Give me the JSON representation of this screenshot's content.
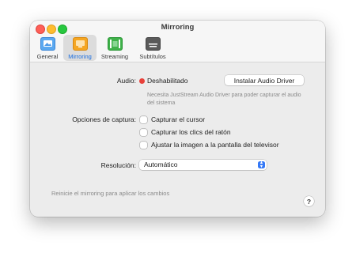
{
  "window": {
    "title": "Mirroring"
  },
  "toolbar": {
    "tabs": [
      {
        "label": "General",
        "icon": "general-icon"
      },
      {
        "label": "Mirroring",
        "icon": "mirroring-icon",
        "selected": true
      },
      {
        "label": "Streaming",
        "icon": "streaming-icon"
      },
      {
        "label": "Subtítulos",
        "icon": "subtitles-icon"
      }
    ]
  },
  "audio": {
    "label": "Audio:",
    "status": "Deshabilitado",
    "status_color": "#e8413a",
    "install_button": "Instalar Audio Driver",
    "hint": "Necesita JustStream Audio Driver para poder capturar el audio del sistema"
  },
  "capture": {
    "label": "Opciones de captura:",
    "options": [
      {
        "label": "Capturar el cursor",
        "checked": false
      },
      {
        "label": "Capturar los clics del ratón",
        "checked": false
      },
      {
        "label": "Ajustar la imagen a la pantalla del televisor",
        "checked": false
      }
    ]
  },
  "resolution": {
    "label": "Resolución:",
    "value": "Automático"
  },
  "footer": {
    "note": "Reinicie el mirroring para aplicar los cambios",
    "help": "?"
  },
  "colors": {
    "accent": "#3478f6",
    "selected_tab_text": "#1a6ee0"
  }
}
